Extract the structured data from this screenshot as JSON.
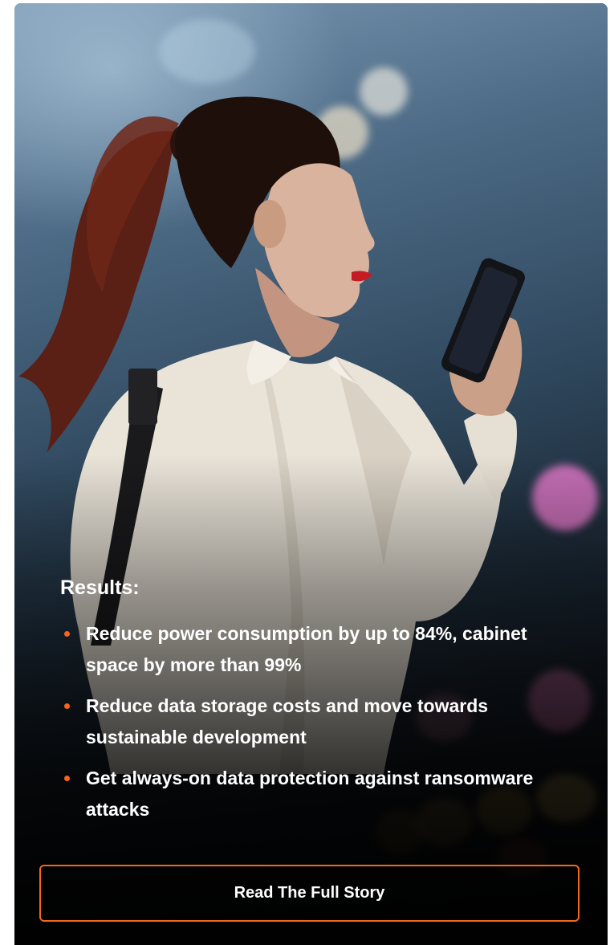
{
  "card": {
    "image_description_icon": "woman-looking-at-phone-photo",
    "results": {
      "title": "Results:",
      "items": [
        {
          "text": "Reduce power consumption by up to 84%, cabinet space by more than 99%"
        },
        {
          "text": "Reduce data storage costs and move towards sustainable development"
        },
        {
          "text": "Get always-on data protection against ransomware attacks"
        }
      ]
    },
    "cta": {
      "label": "Read The Full Story"
    }
  },
  "colors": {
    "accent": "#f5661c",
    "text": "#ffffff",
    "background": "#0b0b0c"
  }
}
